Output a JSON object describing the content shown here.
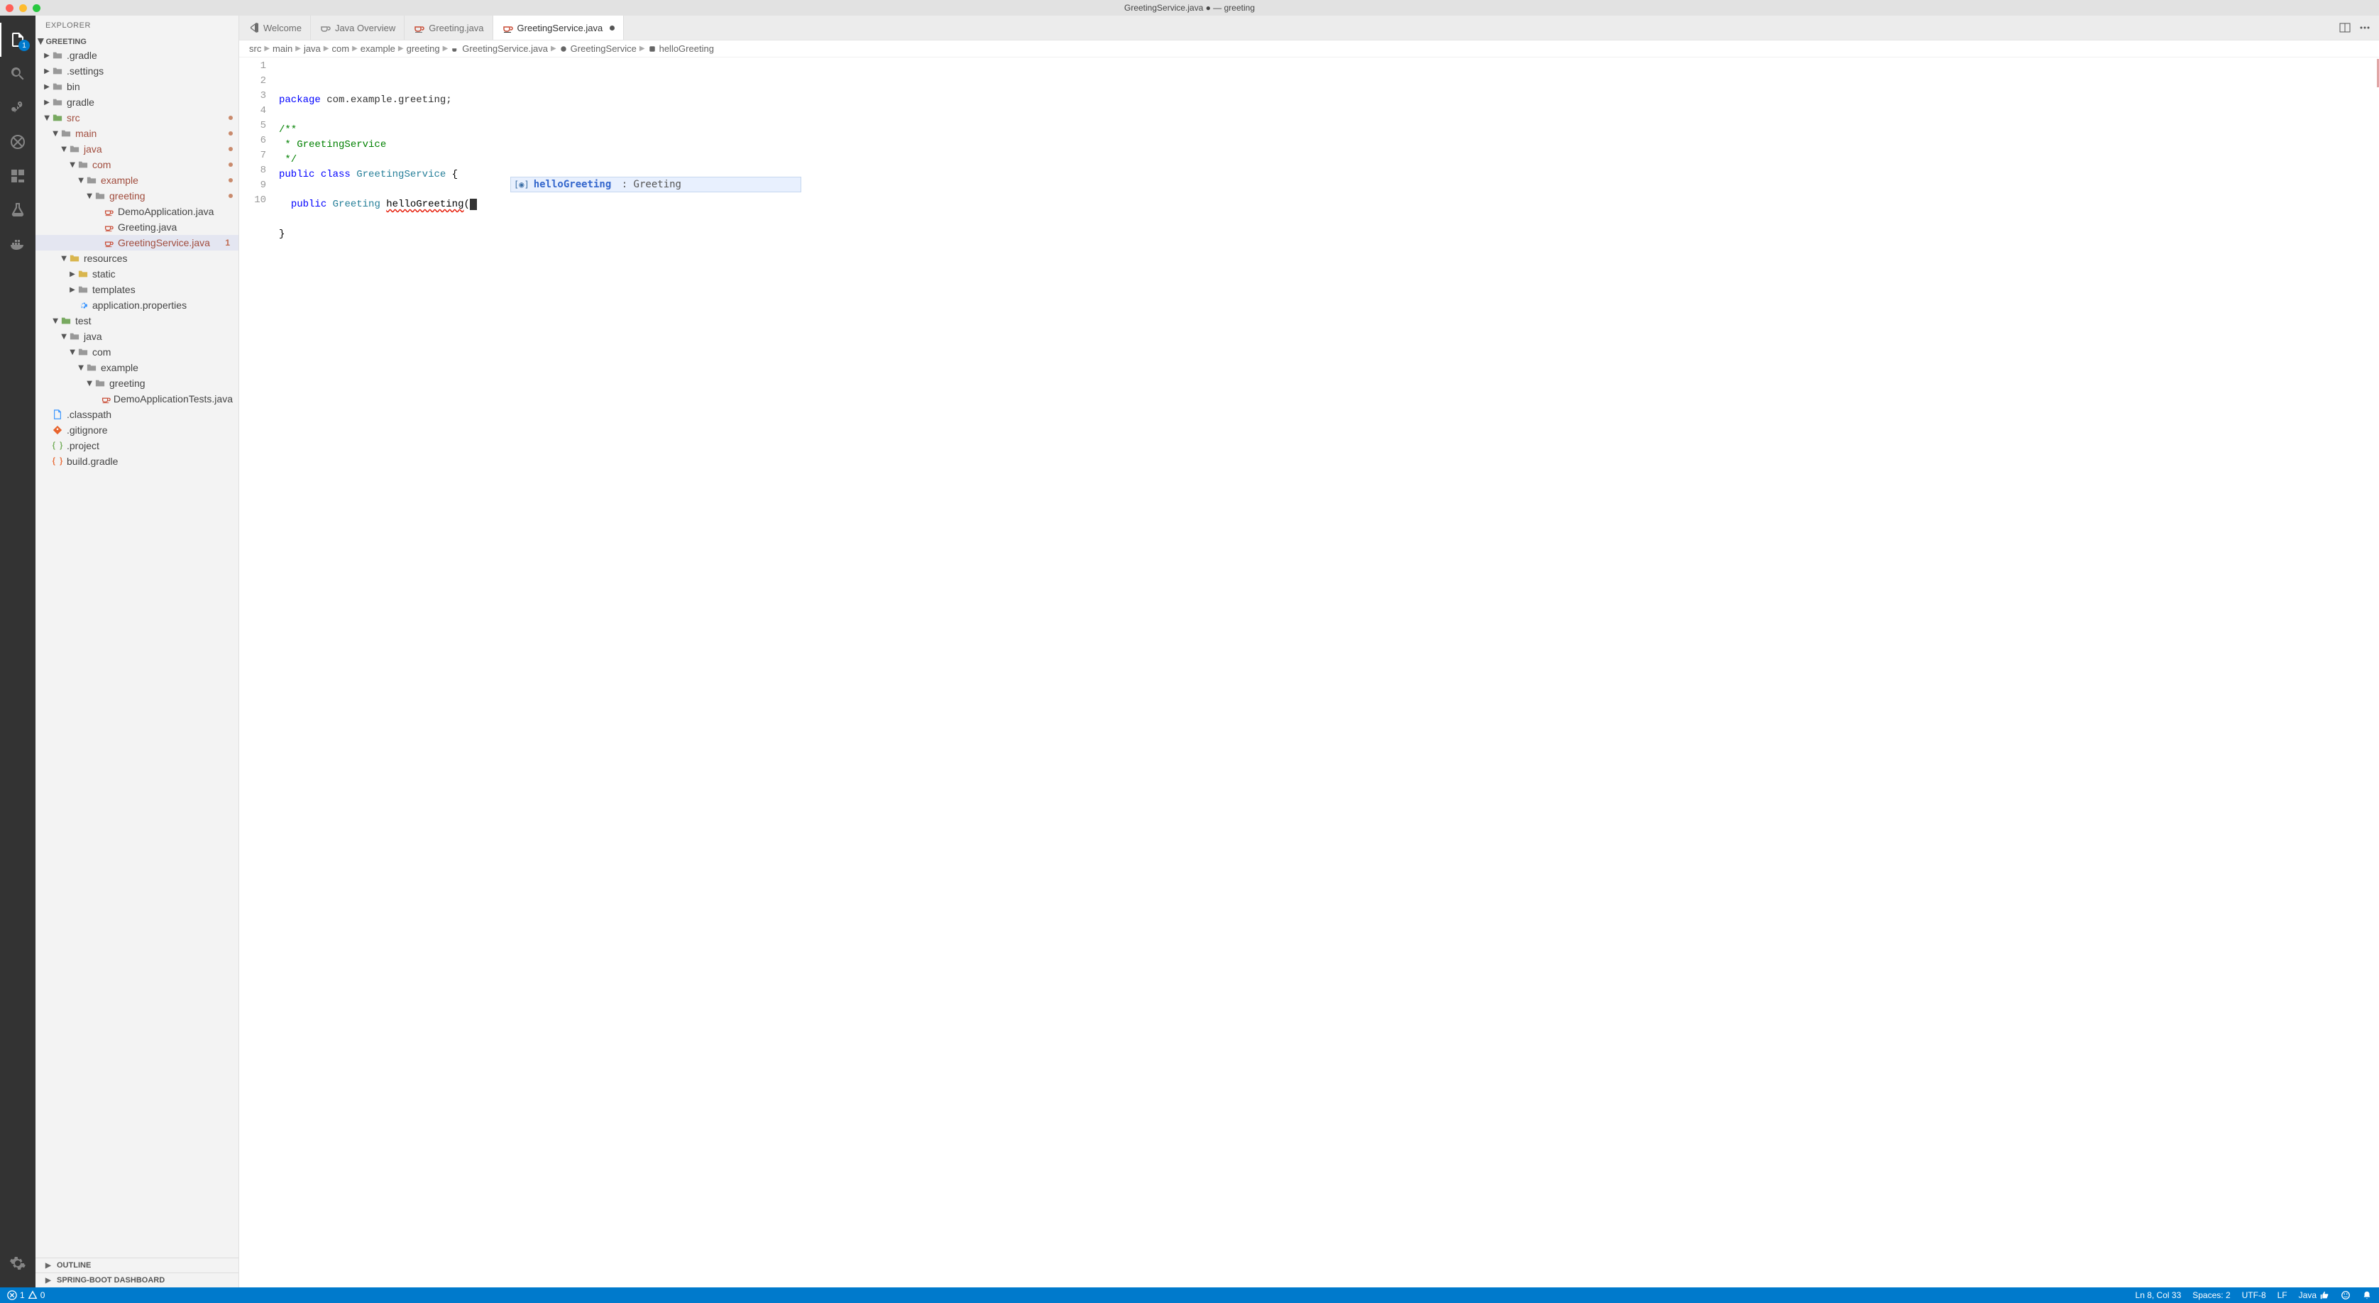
{
  "titlebar": {
    "title": "GreetingService.java ● — greeting"
  },
  "activityBar": {
    "explorer_badge": "1"
  },
  "sidebar": {
    "header": "EXPLORER",
    "root_section": "GREETING",
    "tree": [
      {
        "depth": 0,
        "name": ".gradle",
        "icon": "folder-generic",
        "twisty": "closed"
      },
      {
        "depth": 0,
        "name": ".settings",
        "icon": "folder-generic",
        "twisty": "closed"
      },
      {
        "depth": 0,
        "name": "bin",
        "icon": "folder-generic",
        "twisty": "closed"
      },
      {
        "depth": 0,
        "name": "gradle",
        "icon": "folder-generic",
        "twisty": "closed"
      },
      {
        "depth": 0,
        "name": "src",
        "icon": "folder-src",
        "twisty": "open",
        "modified": true,
        "dot": true
      },
      {
        "depth": 1,
        "name": "main",
        "icon": "folder-generic",
        "twisty": "open",
        "modified": true,
        "dot": true
      },
      {
        "depth": 2,
        "name": "java",
        "icon": "folder-generic",
        "twisty": "open",
        "modified": true,
        "dot": true
      },
      {
        "depth": 3,
        "name": "com",
        "icon": "folder-generic",
        "twisty": "open",
        "modified": true,
        "dot": true
      },
      {
        "depth": 4,
        "name": "example",
        "icon": "folder-generic",
        "twisty": "open",
        "modified": true,
        "dot": true
      },
      {
        "depth": 5,
        "name": "greeting",
        "icon": "folder-generic",
        "twisty": "open",
        "modified": true,
        "dot": true
      },
      {
        "depth": 6,
        "name": "DemoApplication.java",
        "icon": "java-cup"
      },
      {
        "depth": 6,
        "name": "Greeting.java",
        "icon": "java-cup"
      },
      {
        "depth": 6,
        "name": "GreetingService.java",
        "icon": "java-cup",
        "modified": true,
        "active": true,
        "badge": "1"
      },
      {
        "depth": 2,
        "name": "resources",
        "icon": "folder-resources",
        "twisty": "open"
      },
      {
        "depth": 3,
        "name": "static",
        "icon": "folder-resources",
        "twisty": "closed"
      },
      {
        "depth": 3,
        "name": "templates",
        "icon": "folder-generic",
        "twisty": "closed"
      },
      {
        "depth": 3,
        "name": "application.properties",
        "icon": "gear-blue"
      },
      {
        "depth": 1,
        "name": "test",
        "icon": "folder-special",
        "twisty": "open"
      },
      {
        "depth": 2,
        "name": "java",
        "icon": "folder-generic",
        "twisty": "open"
      },
      {
        "depth": 3,
        "name": "com",
        "icon": "folder-generic",
        "twisty": "open"
      },
      {
        "depth": 4,
        "name": "example",
        "icon": "folder-generic",
        "twisty": "open"
      },
      {
        "depth": 5,
        "name": "greeting",
        "icon": "folder-generic",
        "twisty": "open"
      },
      {
        "depth": 6,
        "name": "DemoApplicationTests.java",
        "icon": "java-cup"
      },
      {
        "depth": 0,
        "name": ".classpath",
        "icon": "file-blue"
      },
      {
        "depth": 0,
        "name": ".gitignore",
        "icon": "git-orange"
      },
      {
        "depth": 0,
        "name": ".project",
        "icon": "json-green"
      },
      {
        "depth": 0,
        "name": "build.gradle",
        "icon": "json-orange"
      }
    ],
    "outline": "OUTLINE",
    "springboot": "SPRING-BOOT DASHBOARD"
  },
  "tabs": [
    {
      "label": "Welcome",
      "icon": "vscode",
      "active": false
    },
    {
      "label": "Java Overview",
      "icon": "java-gray",
      "active": false
    },
    {
      "label": "Greeting.java",
      "icon": "java-cup",
      "active": false
    },
    {
      "label": "GreetingService.java",
      "icon": "java-cup",
      "active": true,
      "dirty": true
    }
  ],
  "breadcrumbs": [
    {
      "label": "src"
    },
    {
      "label": "main"
    },
    {
      "label": "java"
    },
    {
      "label": "com"
    },
    {
      "label": "example"
    },
    {
      "label": "greeting"
    },
    {
      "label": "GreetingService.java",
      "icon": "java-cup"
    },
    {
      "label": "GreetingService",
      "icon": "class-yellow"
    },
    {
      "label": "helloGreeting",
      "icon": "method-purple"
    }
  ],
  "code": {
    "lines": [
      {
        "n": 1,
        "type": "pkg",
        "raw": "package com.example.greeting;"
      },
      {
        "n": 2,
        "type": "blank",
        "raw": ""
      },
      {
        "n": 3,
        "type": "comment",
        "raw": "/**"
      },
      {
        "n": 4,
        "type": "comment",
        "raw": " * GreetingService"
      },
      {
        "n": 5,
        "type": "comment",
        "raw": " */"
      },
      {
        "n": 6,
        "type": "class",
        "raw": "public class GreetingService {"
      },
      {
        "n": 7,
        "type": "blank",
        "raw": ""
      },
      {
        "n": 8,
        "type": "method",
        "raw": "  public Greeting helloGreeting()"
      },
      {
        "n": 9,
        "type": "blank",
        "raw": ""
      },
      {
        "n": 10,
        "type": "plain",
        "raw": "}"
      }
    ]
  },
  "suggestion": {
    "name": "helloGreeting",
    "sep": " : ",
    "type": "Greeting"
  },
  "statusbar": {
    "errors": "1",
    "warnings": "0",
    "line_col": "Ln 8, Col 33",
    "spaces": "Spaces: 2",
    "encoding": "UTF-8",
    "eol": "LF",
    "language": "Java"
  }
}
